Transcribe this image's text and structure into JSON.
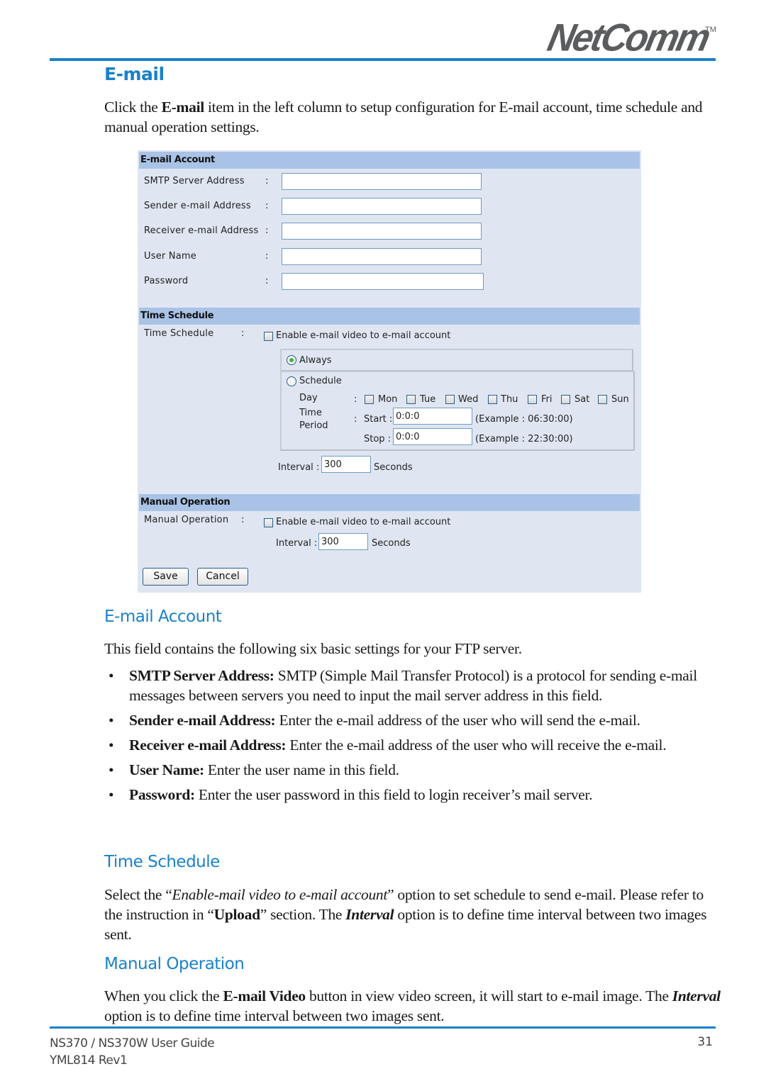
{
  "header": {
    "brand": "NetComm",
    "trademark": "TM",
    "accent_color": "#1a81c8"
  },
  "page_title": "E-mail",
  "intro": {
    "pre": "Click the ",
    "bold": "E-mail",
    "post": " item in the left column to setup configuration for E-mail account, time schedule and manual operation settings."
  },
  "panel": {
    "email_account": {
      "heading": "E-mail Account",
      "fields": [
        {
          "label": "SMTP Server Address",
          "value": ""
        },
        {
          "label": "Sender e-mail Address",
          "value": ""
        },
        {
          "label": "Receiver e-mail Address",
          "value": ""
        },
        {
          "label": "User Name",
          "value": ""
        },
        {
          "label": "Password",
          "value": ""
        }
      ],
      "colon": ":"
    },
    "time_schedule": {
      "heading": "Time Schedule",
      "label": "Time Schedule",
      "enable_label": "Enable e-mail video to e-mail account",
      "enable_checked": false,
      "always_label": "Always",
      "always_selected": true,
      "schedule_label": "Schedule",
      "schedule_selected": false,
      "day_label": "Day",
      "days": [
        {
          "label": "Mon",
          "checked": false
        },
        {
          "label": "Tue",
          "checked": false
        },
        {
          "label": "Wed",
          "checked": false
        },
        {
          "label": "Thu",
          "checked": false
        },
        {
          "label": "Fri",
          "checked": false
        },
        {
          "label": "Sat",
          "checked": false
        },
        {
          "label": "Sun",
          "checked": false
        }
      ],
      "time_label_1": "Time",
      "time_label_2": "Period",
      "start_label": "Start :",
      "start_value": "0:0:0",
      "start_example": "(Example : 06:30:00)",
      "stop_label": "Stop :",
      "stop_value": "0:0:0",
      "stop_example": "(Example : 22:30:00)",
      "interval_label": "Interval :",
      "interval_value": "300",
      "interval_unit": "Seconds"
    },
    "manual_operation": {
      "heading": "Manual Operation",
      "label": "Manual Operation",
      "enable_label": "Enable e-mail video to e-mail account",
      "enable_checked": false,
      "interval_label": "Interval :",
      "interval_value": "300",
      "interval_unit": "Seconds"
    },
    "buttons": {
      "save": "Save",
      "cancel": "Cancel"
    }
  },
  "sections": {
    "email_account": {
      "title": "E-mail Account",
      "intro": "This field contains the following six basic settings for your FTP server.",
      "bullets": [
        {
          "term": "SMTP Server Address:",
          "text": " SMTP (Simple Mail Transfer Protocol) is a protocol for sending e-mail messages between servers you need to input the mail server address in this field."
        },
        {
          "term": "Sender e-mail Address:",
          "text": " Enter the e-mail address of the user who will send the e-mail."
        },
        {
          "term": "Receiver e-mail Address:",
          "text": " Enter the e-mail address of the user who will receive the e-mail."
        },
        {
          "term": "User Name:",
          "text": " Enter the user name in this field."
        },
        {
          "term": "Password:",
          "text": " Enter the user password in this field to login receiver’s mail server."
        }
      ]
    },
    "time_schedule": {
      "title": "Time Schedule",
      "p1": "Select the “",
      "p1_italic": "Enable-mail video to e-mail account",
      "p2": "” option to set schedule to send e-mail. Please refer to the instruction in “",
      "p2_bold": "Upload",
      "p3": "” section.  The ",
      "p3_bolditalic": "Interval",
      "p4": " option is to define time interval between two images sent."
    },
    "manual_operation": {
      "title": "Manual Operation",
      "p1": "When you click the ",
      "p1_bold": "E-mail Video",
      "p2": " button in view video screen, it will start to e-mail image. The ",
      "p2_bolditalic": "Interval",
      "p3": " option is to define time interval between two images sent."
    }
  },
  "footer": {
    "guide": "NS370 / NS370W User Guide",
    "revision": "YML814 Rev1",
    "page_number": "31"
  }
}
